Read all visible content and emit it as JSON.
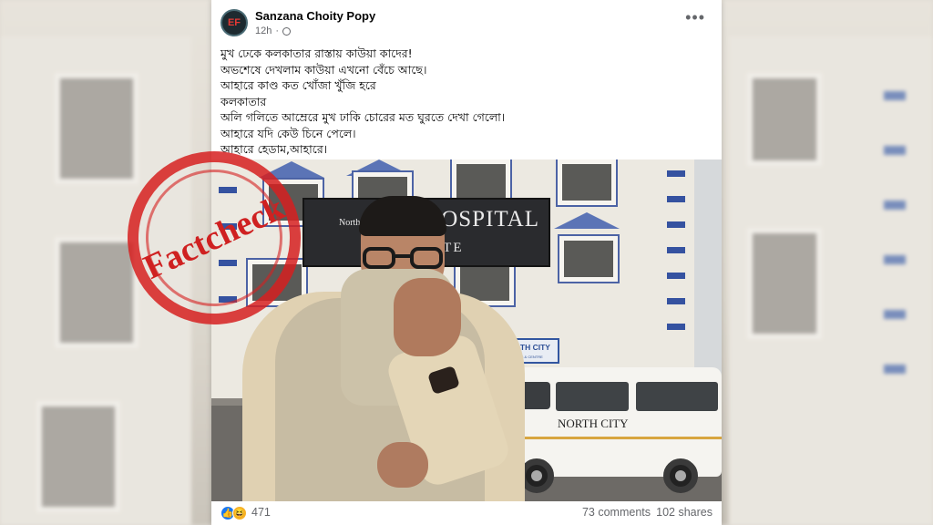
{
  "post": {
    "author": "Sanzana Choity Popy",
    "time": "12h",
    "visibility_icon": "globe-icon",
    "more_icon": "more-options-icon",
    "caption_lines": [
      "মুখ ঢেকে কলকাতার রাস্তায় কাউয়া কাদের!",
      "অভশেষে দেখলাম কাউয়া এখনো বেঁচে আছে।",
      "আহারে কাণ্ড কত খোঁজা খুঁজি হরে",
      "কলকাতার",
      "অলি গলিতে আম্রেরে  মুখ ঢাকি চোরের মত ঘুরতে দেখা গেলো।",
      "আহারে যদি কেউ চিনে পেলে।",
      "আহারে হেডাম,আহারে।"
    ]
  },
  "photo": {
    "stamp_text": "Factcheck",
    "sign_main": "NO     HOSPITAL",
    "sign_prefix": "North",
    "sign_sub": "TITUTE",
    "small_sign_title": "NORTH CITY",
    "small_sign_sub": "NURSING & CENTRE",
    "van_label": "NORTH CITY",
    "stamp_color": "#cf2121"
  },
  "footer": {
    "reactions": [
      "like-icon",
      "haha-icon"
    ],
    "reaction_count": "471",
    "comments": "73 comments",
    "shares": "102 shares"
  }
}
